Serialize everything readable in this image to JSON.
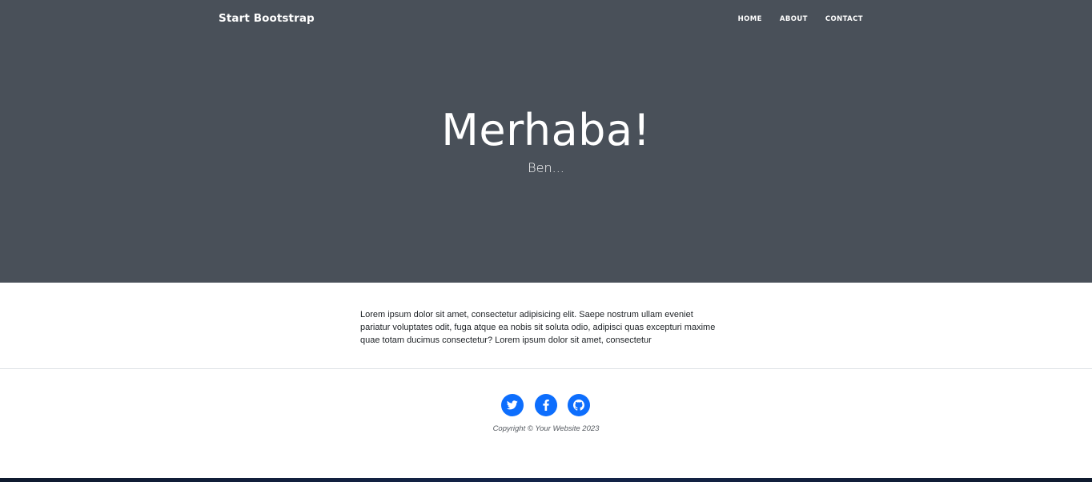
{
  "navbar": {
    "brand": "Start Bootstrap",
    "links": [
      "HOME",
      "ABOUT",
      "CONTACT"
    ]
  },
  "hero": {
    "title": "Merhaba!",
    "subtitle": "Ben..."
  },
  "main": {
    "paragraph": "Lorem ipsum dolor sit amet, consectetur adipisicing elit. Saepe nostrum ullam eveniet pariatur voluptates odit, fuga atque ea nobis sit soluta odio, adipisci quas excepturi maxime quae totam ducimus consectetur? Lorem ipsum dolor sit amet, consectetur"
  },
  "footer": {
    "social_icons": [
      "twitter-icon",
      "facebook-icon",
      "github-icon"
    ],
    "copyright": "Copyright © Your Website 2023"
  },
  "colors": {
    "header_bg": "#495059",
    "accent": "#0d6efd",
    "text": "#212529"
  }
}
